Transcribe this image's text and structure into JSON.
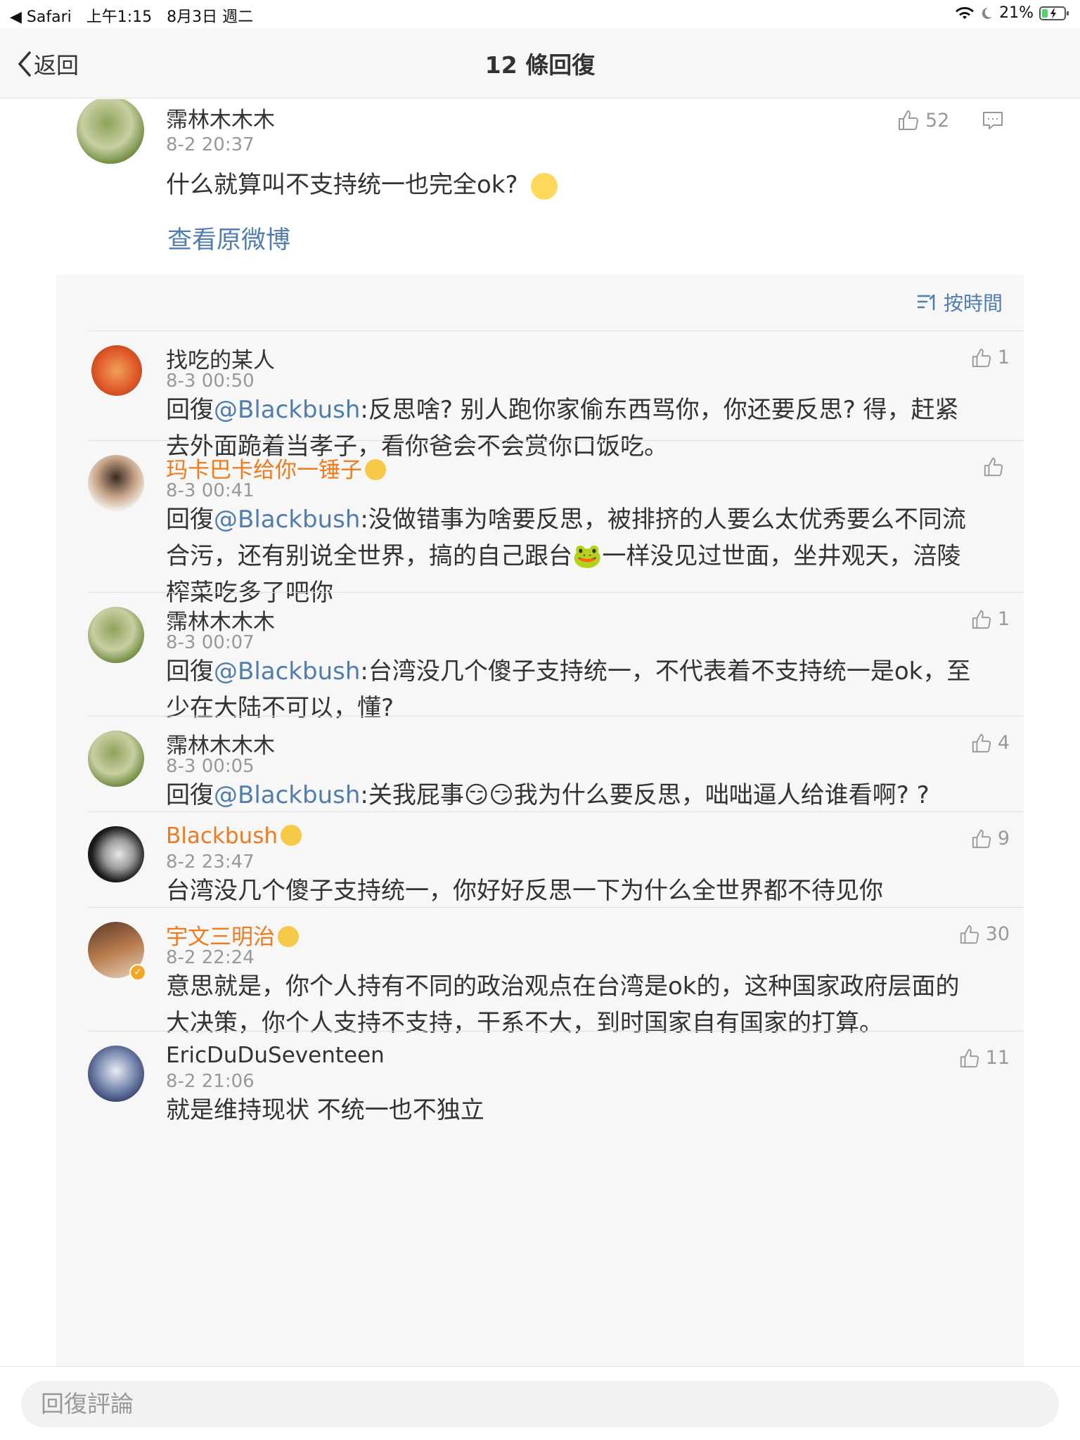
{
  "status_bar": {
    "carrier": "◀ Safari",
    "time": "上午1:15",
    "date": "8月3日 週二",
    "battery": "21%"
  },
  "nav": {
    "back_label": "返回",
    "title": "12 條回復"
  },
  "main_comment": {
    "user": "霈林木木木",
    "time": "8-2 20:37",
    "text": "什么就算叫不支持统一也完全ok?",
    "likes": "52",
    "view_original": "查看原微博"
  },
  "sort_label": "按時間",
  "replies": [
    {
      "user": "找吃的某人",
      "time": "8-3 00:50",
      "likes": "1",
      "prefix": "回復",
      "mention": "@Blackbush",
      "text": ":反思啥? 别人跑你家偷东西骂你，你还要反思? 得，赶紧去外面跪着当孝子，看你爸会不会赏你口饭吃。"
    },
    {
      "user": "玛卡巴卡给你一锤子",
      "time": "8-3 00:41",
      "likes": "",
      "prefix": "回復",
      "mention": "@Blackbush",
      "text": ":没做错事为啥要反思，被排挤的人要么太优秀要么不同流合污，还有别说全世界，搞的自己跟台🐸一样没见过世面，坐井观天，涪陵榨菜吃多了吧你"
    },
    {
      "user": "霈林木木木",
      "time": "8-3 00:07",
      "likes": "1",
      "prefix": "回復",
      "mention": "@Blackbush",
      "text": ":台湾没几个傻子支持统一，不代表着不支持统一是ok，至少在大陆不可以，懂?"
    },
    {
      "user": "霈林木木木",
      "time": "8-3 00:05",
      "likes": "4",
      "prefix": "回復",
      "mention": "@Blackbush",
      "text": ":关我屁事😏😏我为什么要反思，咄咄逼人给谁看啊? ?"
    },
    {
      "user": "Blackbush",
      "time": "8-2 23:47",
      "likes": "9",
      "prefix": "",
      "mention": "",
      "text": "台湾没几个傻子支持统一，你好好反思一下为什么全世界都不待见你"
    },
    {
      "user": "宇文三明治",
      "time": "8-2 22:24",
      "likes": "30",
      "prefix": "",
      "mention": "",
      "text": "意思就是，你个人持有不同的政治观点在台湾是ok的，这种国家政府层面的大决策，你个人支持不支持，干系不大，到时国家自有国家的打算。"
    },
    {
      "user": "EricDuDuSeventeen",
      "time": "8-2 21:06",
      "likes": "11",
      "prefix": "",
      "mention": "",
      "text": "就是维持现状 不统一也不独立"
    }
  ],
  "reply_input_placeholder": "回復評論",
  "colors": {
    "link": "#507daf",
    "vip_name": "#f07b1c",
    "meta": "#999999"
  }
}
